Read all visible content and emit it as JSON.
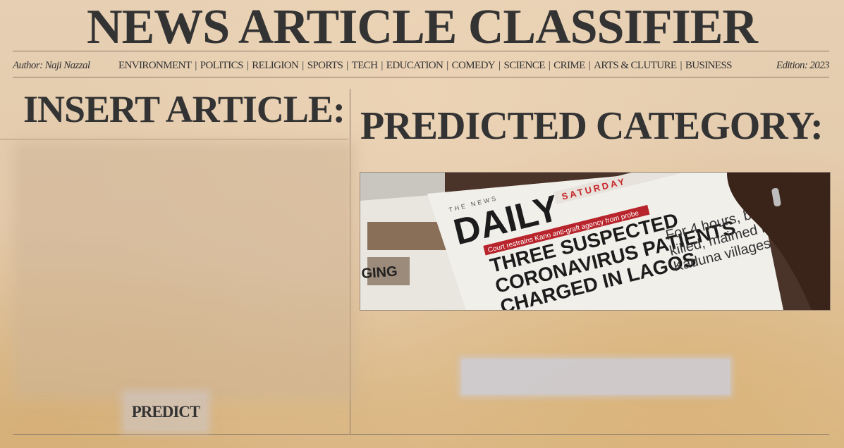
{
  "header": {
    "title": "NEWS ARTICLE CLASSIFIER",
    "author": "Author: Naji Nazzal",
    "edition": "Edition: 2023",
    "categories": [
      "ENVIRONMENT",
      "POLITICS",
      "RELIGION",
      "SPORTS",
      "TECH",
      "EDUCATION",
      "COMEDY",
      "SCIENCE",
      "CRIME",
      "ARTS & CLUTURE",
      "BUSINESS"
    ],
    "separator": "|"
  },
  "input_panel": {
    "heading": "INSERT ARTICLE:",
    "article_value": "",
    "predict_label": "PREDICT"
  },
  "output_panel": {
    "heading": "PREDICTED CATEGORY:",
    "result": "",
    "photo": {
      "masthead": "DAILY",
      "kicker": "THE NEWS",
      "day": "SATURDAY",
      "strap": "Court restrains Kano anti-graft agency from probe",
      "headline": [
        "THREE SUSPECTED",
        "CORONAVIRUS PATIENTS",
        "CHARGED IN LAGOS"
      ],
      "subhead": [
        "For 4 hours, band",
        "killed, maimed in",
        "Kaduna villages"
      ],
      "left_page_word": "GING"
    }
  },
  "colors": {
    "ink": "#333333",
    "paper": "#e3c9a9",
    "rule": "#8a7a6a"
  }
}
